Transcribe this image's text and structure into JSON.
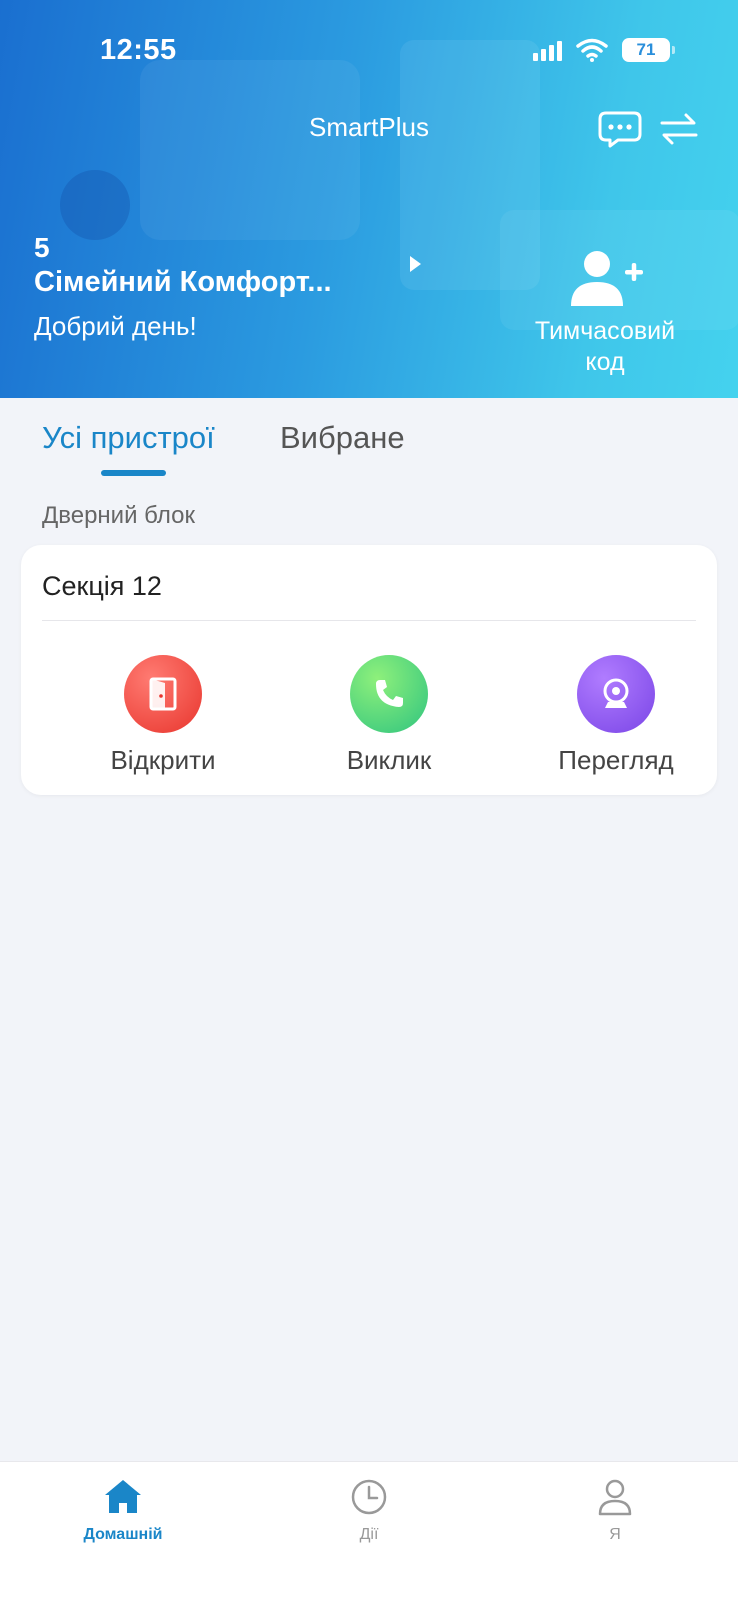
{
  "status": {
    "time": "12:55",
    "battery": "71"
  },
  "header": {
    "title": "SmartPlus",
    "community_number": "5",
    "community_name": "Сімейний Комфорт...",
    "greeting": "Добрий день!",
    "temp_code_label": "Тимчасовий код"
  },
  "tabs": [
    {
      "label": "Усі пристрої",
      "active": true
    },
    {
      "label": "Вибране",
      "active": false
    }
  ],
  "section": {
    "label": "Дверний блок"
  },
  "device": {
    "name": "Секція 12",
    "actions": [
      {
        "label": "Відкрити",
        "icon": "door-icon",
        "color": "#e8352d"
      },
      {
        "label": "Виклик",
        "icon": "phone-icon",
        "color": "#2fc47f"
      },
      {
        "label": "Перегляд",
        "icon": "camera-icon",
        "color": "#7a45e6"
      }
    ]
  },
  "bottom_nav": [
    {
      "label": "Домашній",
      "icon": "home-icon",
      "active": true
    },
    {
      "label": "Дії",
      "icon": "clock-icon",
      "active": false
    },
    {
      "label": "Я",
      "icon": "person-icon",
      "active": false
    }
  ],
  "colors": {
    "accent": "#1a86c8",
    "background": "#f2f4f9"
  }
}
